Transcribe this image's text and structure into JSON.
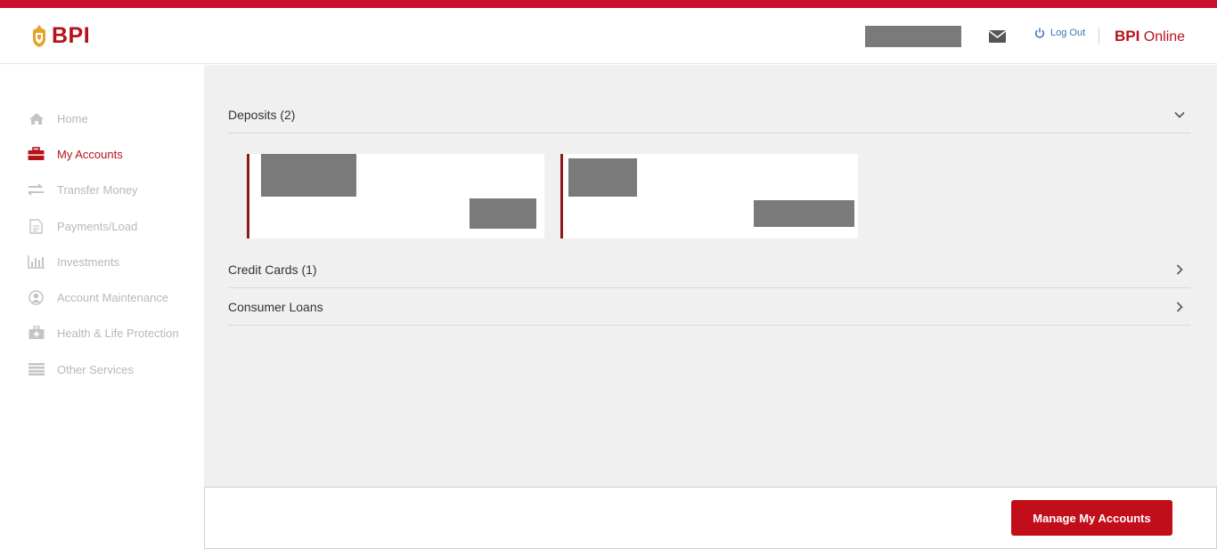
{
  "header": {
    "logo_text": "BPI",
    "logout_label": "Log Out",
    "brand_bold": "BPI",
    "brand_rest": "Online"
  },
  "sidebar": {
    "items": [
      {
        "label": "Home",
        "icon": "home-icon"
      },
      {
        "label": "My Accounts",
        "icon": "briefcase-icon",
        "active": true
      },
      {
        "label": "Transfer Money",
        "icon": "transfer-arrows-icon"
      },
      {
        "label": "Payments/Load",
        "icon": "document-icon"
      },
      {
        "label": "Investments",
        "icon": "bar-chart-icon"
      },
      {
        "label": "Account Maintenance",
        "icon": "user-circle-icon"
      },
      {
        "label": "Health & Life Protection",
        "icon": "medical-kit-icon"
      },
      {
        "label": "Other Services",
        "icon": "list-icon"
      }
    ]
  },
  "main": {
    "sections": [
      {
        "title": "Deposits (2)",
        "expanded": true
      },
      {
        "title": "Credit Cards (1)",
        "expanded": false
      },
      {
        "title": "Consumer Loans",
        "expanded": false
      }
    ]
  },
  "footer": {
    "manage_label": "Manage My Accounts"
  },
  "colors": {
    "brand_red": "#c8102e",
    "accent_dark_red": "#8e1b1b",
    "link_blue": "#3a74b8",
    "sidebar_text": "#b8b8b8",
    "main_bg": "#f0f0f0"
  }
}
